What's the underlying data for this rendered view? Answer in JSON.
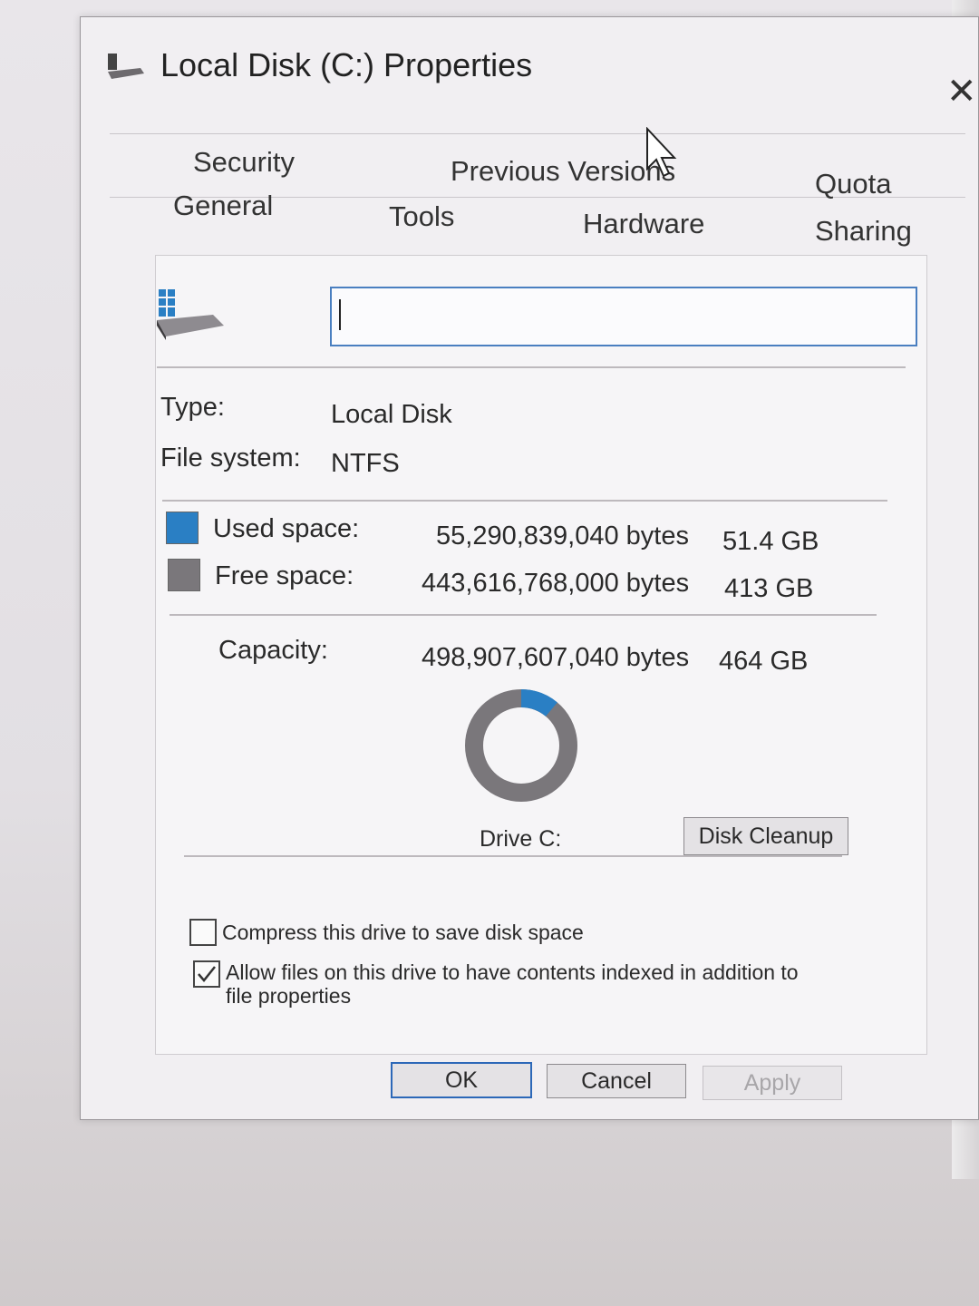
{
  "window": {
    "title": "Local Disk (C:) Properties",
    "close_glyph": "✕"
  },
  "tabs": {
    "row1": [
      "Security",
      "Previous Versions",
      "Quota"
    ],
    "row2": [
      "General",
      "Tools",
      "Hardware",
      "Sharing"
    ],
    "active": "General"
  },
  "general": {
    "name_value": "",
    "type_label": "Type:",
    "type_value": "Local Disk",
    "fs_label": "File system:",
    "fs_value": "NTFS",
    "used_label": "Used space:",
    "used_bytes": "55,290,839,040 bytes",
    "used_size": "51.4 GB",
    "free_label": "Free space:",
    "free_bytes": "443,616,768,000 bytes",
    "free_size": "413 GB",
    "capacity_label": "Capacity:",
    "capacity_bytes": "498,907,607,040 bytes",
    "capacity_size": "464 GB",
    "used_fraction": 0.111,
    "drive_label": "Drive C:",
    "disk_cleanup": "Disk Cleanup",
    "compress_label": "Compress this drive to save disk space",
    "compress_checked": false,
    "index_label_line1": "Allow files on this drive to have contents indexed in addition to",
    "index_label_line2": "file properties",
    "index_checked": true
  },
  "buttons": {
    "ok": "OK",
    "cancel": "Cancel",
    "apply": "Apply"
  },
  "colors": {
    "used": "#2a7fc4",
    "free": "#7a777b",
    "focus": "#2c68b8"
  },
  "icons": [
    "drive-icon",
    "close-icon",
    "mouse-cursor-icon"
  ]
}
